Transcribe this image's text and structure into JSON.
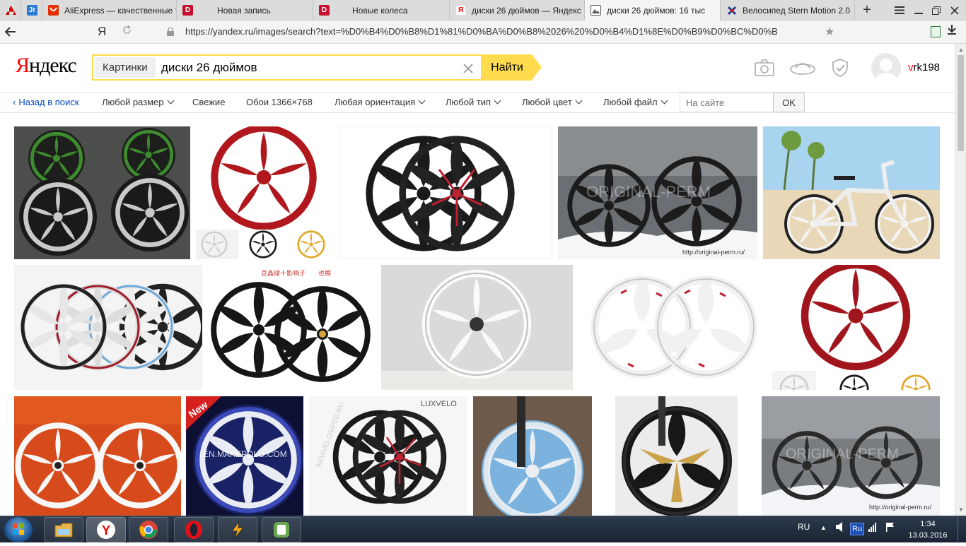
{
  "browser": {
    "tabs": [
      {
        "label": "",
        "favicon": "mitsubishi-icon",
        "color": "#d00000"
      },
      {
        "label": "",
        "favicon": "jr-icon",
        "color": "#2a7bd4"
      },
      {
        "label": "AliExpress — качественные т",
        "favicon": "aliexpress-icon",
        "color": "#e62e04"
      },
      {
        "label": "Новая запись",
        "favicon": "d-icon",
        "color": "#c8102e"
      },
      {
        "label": "Новые колеса",
        "favicon": "d-icon",
        "color": "#c8102e"
      },
      {
        "label": "диски 26 дюймов — Яндекс",
        "favicon": "yandex-icon",
        "color": "#f00"
      },
      {
        "label": "диски 26 дюймов: 16 тыс",
        "favicon": "images-icon",
        "color": "#444"
      },
      {
        "label": "Велосипед Stern Motion 2.0",
        "favicon": "sportmaster-icon",
        "color": "#1f3a93"
      }
    ],
    "new_tab": "+",
    "url": "https://yandex.ru/images/search?text=%D0%B4%D0%B8%D1%81%D0%BA%D0%B8%2026%20%D0%B4%D1%8E%D0%B9%D0%BC%D0%B",
    "ya_button": "Я"
  },
  "header": {
    "logo_part1": "Я",
    "logo_part2": "ндекс",
    "search_tag": "Картинки",
    "search_query": "диски 26 дюймов",
    "find_button": "Найти",
    "username_first": "v",
    "username_rest": "rk198"
  },
  "filters": {
    "back": "Назад в поиск",
    "size": "Любой размер",
    "fresh": "Свежие",
    "wallpapers": "Обои 1366×768",
    "orientation": "Любая ориентация",
    "type": "Любой тип",
    "color": "Любой цвет",
    "file": "Любой файл",
    "site_placeholder": "На сайте",
    "ok": "OK"
  },
  "images": {
    "watermark_original_perm": "ORIGINAL-PERM",
    "url_original_perm": "http://original-perm.ru/",
    "brand_luxvelo": "LUXVELO",
    "watermark_makepolo": "EN.MAKEPOLO.COM",
    "badge_new": "New",
    "watermark_newvelosiped": "NEWVELOSIPED.RU",
    "chinese_caption": "豆晶球十影响子　　也棉"
  },
  "taskbar": {
    "lang": "RU",
    "tray_lang": "Ru",
    "time": "1:34",
    "date": "13.03.2016"
  },
  "colors": {
    "yandex_yellow": "#ffdb4d",
    "yandex_red": "#ff0000",
    "link_blue": "#0044bb"
  }
}
